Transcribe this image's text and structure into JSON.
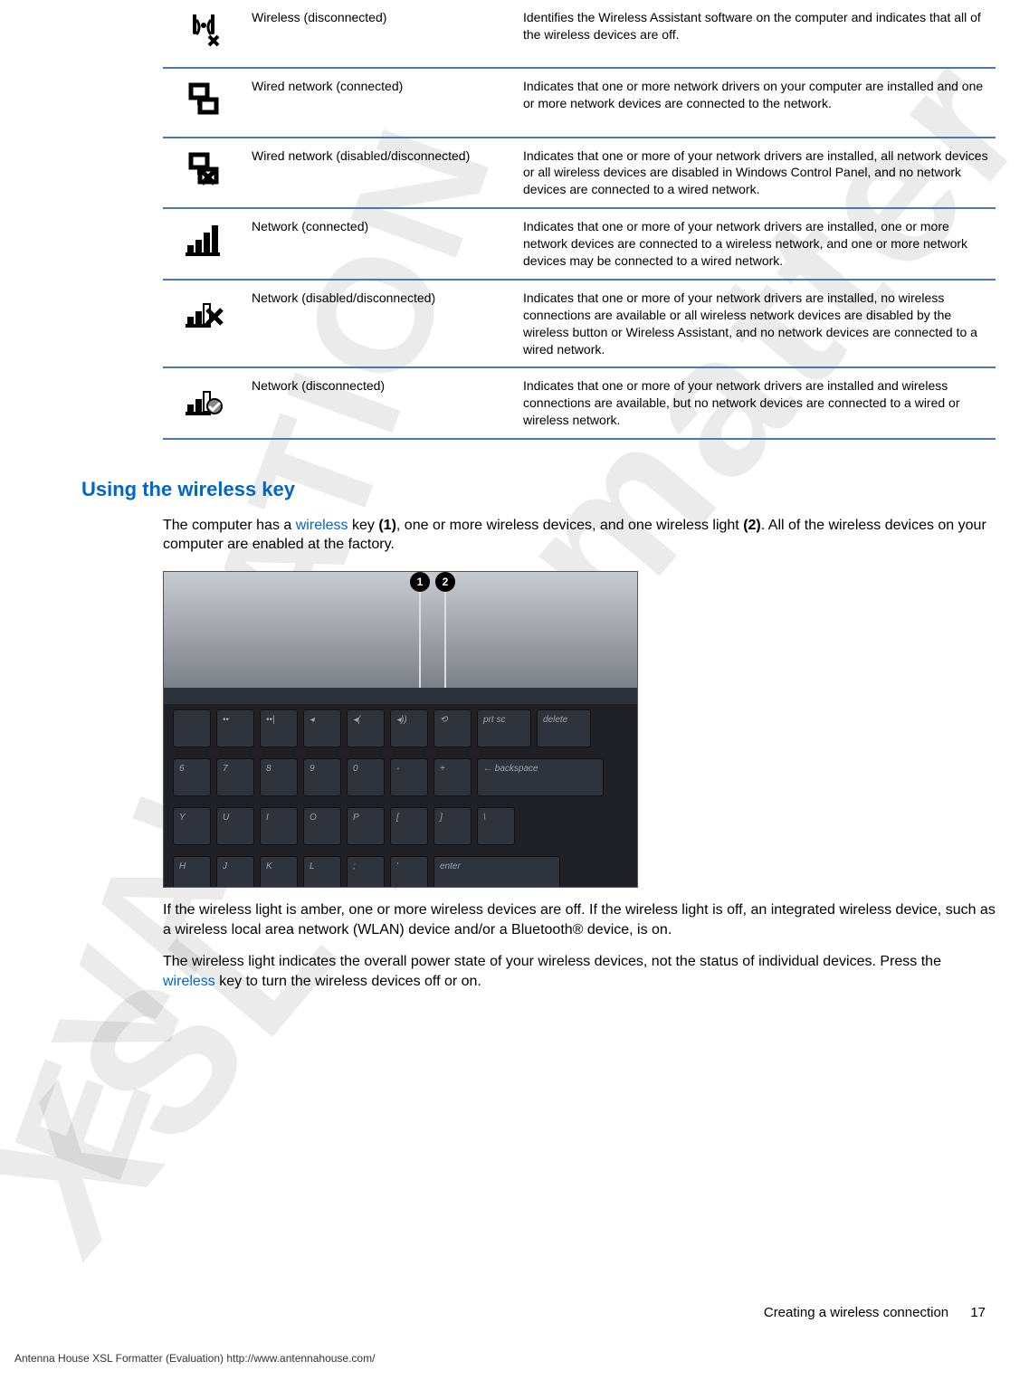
{
  "watermarks": {
    "xsl": "XSL Formatter",
    "eval": "EVALUATION"
  },
  "table": {
    "rows": [
      {
        "icon": "wireless-off",
        "name": "Wireless (disconnected)",
        "desc": "Identifies the Wireless Assistant software on the computer and indicates that all of the wireless devices are off."
      },
      {
        "icon": "wired-on",
        "name": "Wired network (connected)",
        "desc": "Indicates that one or more network drivers on your computer are installed and one or more network devices are connected to the network."
      },
      {
        "icon": "wired-off",
        "name": "Wired network (disabled/disconnected)",
        "desc": "Indicates that one or more of your network drivers are installed, all network devices or all wireless devices are disabled in Windows Control Panel, and no network devices are connected to a wired network."
      },
      {
        "icon": "net-on",
        "name": "Network (connected)",
        "desc": "Indicates that one or more of your network drivers are installed, one or more network devices are connected to a wireless network, and one or more network devices may be connected to a wired network."
      },
      {
        "icon": "net-off",
        "name": "Network (disabled/disconnected)",
        "desc": "Indicates that one or more of your network drivers are installed, no wireless connections are available or all wireless network devices are disabled by the wireless button or Wireless Assistant, and no network devices are connected to a wired network."
      },
      {
        "icon": "net-disc",
        "name": "Network (disconnected)",
        "desc": "Indicates that one or more of your network drivers are installed and wireless connections are available, but no network devices are connected to a wired or wireless network."
      }
    ]
  },
  "section_heading": "Using the wireless key",
  "para1": {
    "pre": "The computer has a ",
    "link1": "wireless",
    "mid1": " key ",
    "b1": "(1)",
    "mid2": ", one or more wireless devices, and one wireless light ",
    "b2": "(2)",
    "post": ". All of the wireless devices on your computer are enabled at the factory."
  },
  "figure": {
    "callouts": [
      "1",
      "2"
    ],
    "keys_row1": [
      "",
      "••",
      "••|",
      "◂",
      "◂(",
      "◂))",
      "⟲",
      "prt sc",
      "delete"
    ],
    "keys_row2": [
      "6",
      "7",
      "8",
      "9",
      "0",
      "-",
      "+",
      "← backspace"
    ],
    "keys_row3": [
      "Y",
      "U",
      "I",
      "O",
      "P",
      "[",
      "]",
      "\\"
    ],
    "keys_row4": [
      "H",
      "J",
      "K",
      "L",
      ";",
      "'",
      "enter"
    ]
  },
  "para2": "If the wireless light is amber, one or more wireless devices are off. If the wireless light is off, an integrated wireless device, such as a wireless local area network (WLAN) device and/or a Bluetooth® device, is on.",
  "para3": {
    "pre": "The wireless light indicates the overall power state of your wireless devices, not the status of individual devices. Press the ",
    "link": "wireless",
    "post": " key to turn the wireless devices off or on."
  },
  "footer": {
    "section": "Creating a wireless connection",
    "page": "17"
  },
  "imprint": "Antenna House XSL Formatter (Evaluation)  http://www.antennahouse.com/"
}
